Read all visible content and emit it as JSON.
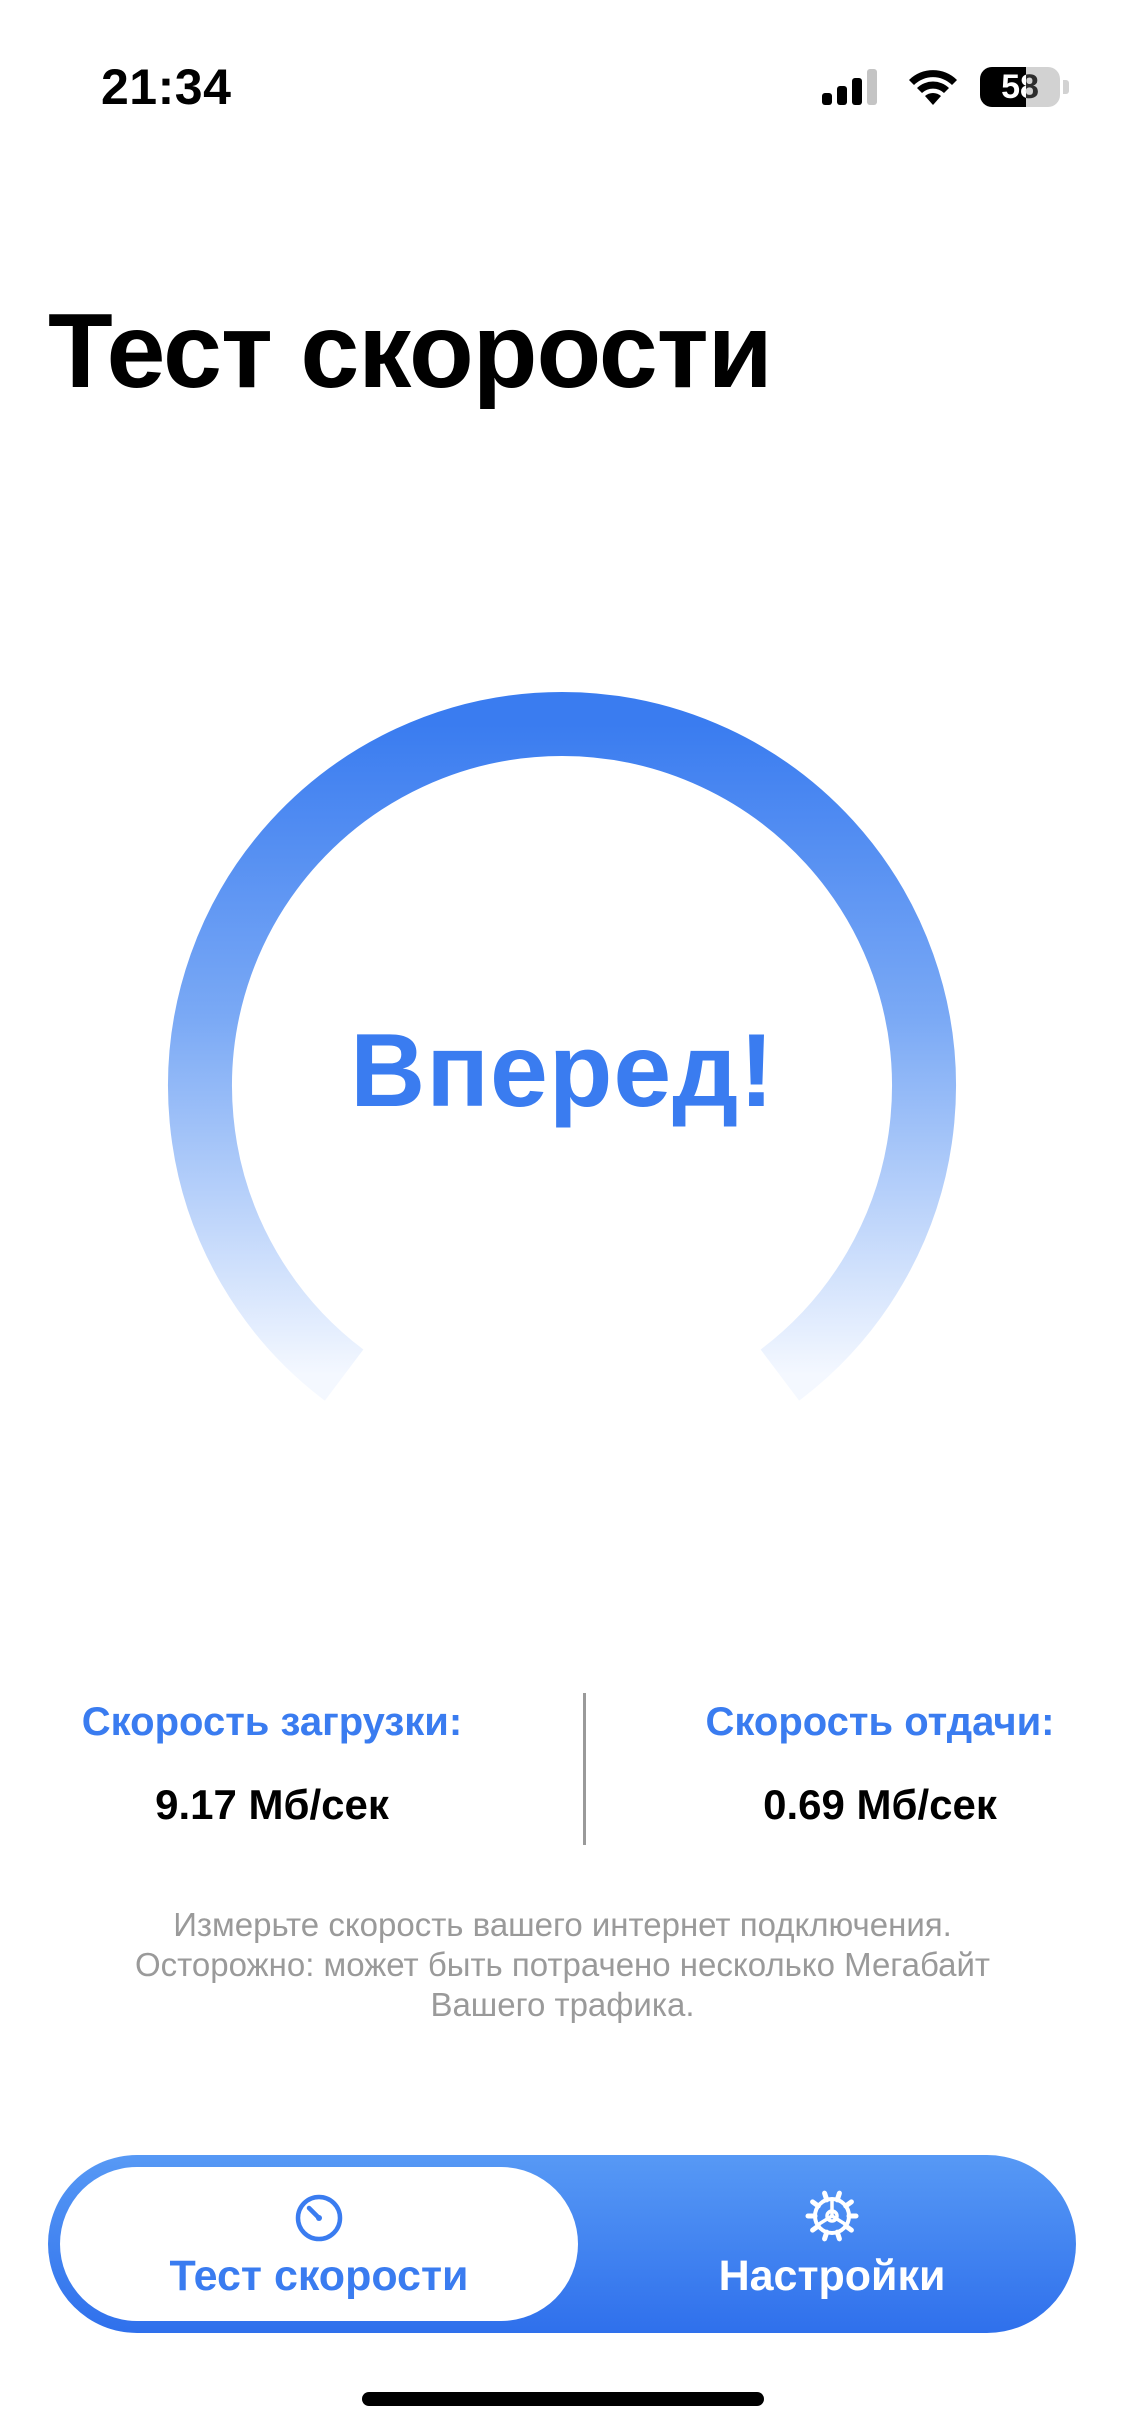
{
  "status_bar": {
    "time": "21:34",
    "battery_level": "58",
    "icons": [
      "signal-icon",
      "wifi-icon",
      "battery-icon"
    ]
  },
  "title": "Тест скорости",
  "gauge": {
    "button_label": "Вперед!",
    "progress": 0
  },
  "speeds": {
    "download_label": "Скорость загрузки:",
    "download_value": "9.17 Мб/сек",
    "upload_label": "Скорость отдачи:",
    "upload_value": "0.69 Мб/сек"
  },
  "info_lines": [
    "Измерьте скорость вашего интернет подключения.",
    "Осторожно: может быть потрачено несколько Мегабайт",
    "Вашего трафика."
  ],
  "tab_bar": {
    "tabs": [
      {
        "label": "Тест скорости",
        "icon": "speedometer-icon",
        "active": true
      },
      {
        "label": "Настройки",
        "icon": "gear-icon",
        "active": false
      }
    ]
  },
  "colors": {
    "accent": "#3a7cf0",
    "tab_bar_top": "#5799f5",
    "tab_bar_bottom": "#2f70ec",
    "muted_text": "#9a9a9a"
  }
}
